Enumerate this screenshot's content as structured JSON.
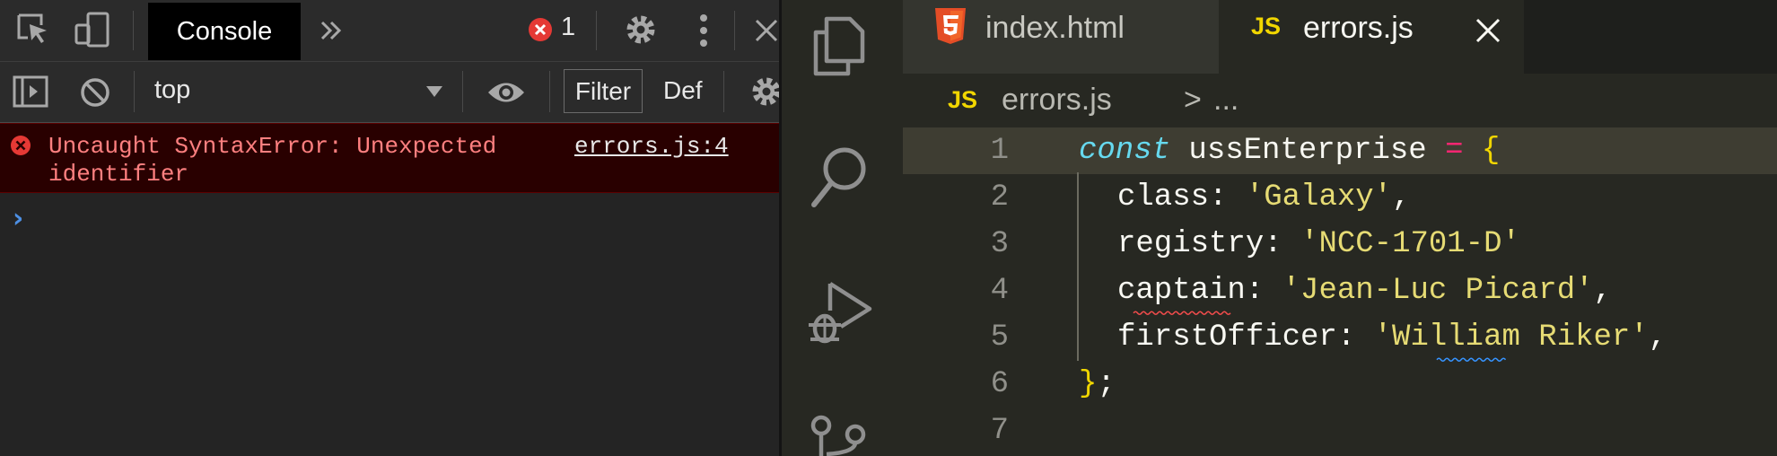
{
  "devtools": {
    "toolbar": {
      "console_tab_label": "Console",
      "more_tabs_icon": "double-chevron-right-icon",
      "error_count": "1",
      "icons": [
        "inspect-element-icon",
        "device-toolbar-icon",
        "error-icon",
        "settings-gear-icon",
        "kebab-menu-icon",
        "close-icon"
      ]
    },
    "filter_bar": {
      "context_value": "top",
      "filter_label": "Filter",
      "levels_label": "Def",
      "icons": [
        "sidebar-toggle-icon",
        "clear-console-icon",
        "dropdown-triangle-icon",
        "eye-icon",
        "settings-gear-icon"
      ]
    },
    "console": {
      "error_message": "Uncaught SyntaxError: Unexpected identifier",
      "error_source": "errors.js:4",
      "prompt_icon": "prompt-chevron-icon"
    },
    "colors": {
      "error_bg": "#290000",
      "error_text": "#ff8080",
      "error_badge": "#e53935",
      "prompt": "#4d8fe3"
    }
  },
  "vscode": {
    "activity_icons": [
      "explorer-files-icon",
      "search-icon",
      "run-debug-icon",
      "source-control-icon"
    ],
    "tabs": [
      {
        "label": "index.html",
        "icon": "html5-icon",
        "active": false
      },
      {
        "label": "errors.js",
        "icon_label": "JS",
        "active": true,
        "close_icon": "close-icon"
      }
    ],
    "breadcrumb": {
      "icon_label": "JS",
      "file": "errors.js",
      "separator": ">",
      "rest": "..."
    },
    "editor": {
      "line_numbers": [
        "1",
        "2",
        "3",
        "4",
        "5",
        "6",
        "7"
      ],
      "lines": [
        {
          "kw": "const",
          "name": " ussEnterprise ",
          "op": "=",
          "open": " {"
        },
        {
          "prop": "class",
          "colon": ": ",
          "str": "'Galaxy'",
          "tail": ","
        },
        {
          "prop": "registry",
          "colon": ": ",
          "str": "'NCC-1701-D'",
          "tail": ""
        },
        {
          "prop": "captain",
          "colon": ": ",
          "str": "'Jean-Luc Picard'",
          "tail": ","
        },
        {
          "prop": "firstOfficer",
          "colon": ": ",
          "str": "'William Riker'",
          "tail": ","
        },
        {
          "close": "}",
          "semi": ";"
        },
        {}
      ]
    },
    "colors": {
      "keyword": "#66d9ef",
      "operator": "#f92672",
      "string": "#e6db74",
      "brace": "#f1d600",
      "js_badge": "#f1d600",
      "html5": "#e44d26"
    }
  }
}
